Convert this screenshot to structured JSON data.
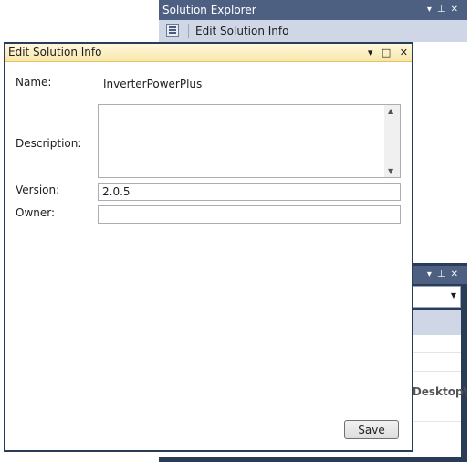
{
  "solution_explorer": {
    "title": "Solution Explorer",
    "title_buttons": [
      "▾",
      "⊥",
      "✕"
    ],
    "toolbar": {
      "label": "Edit Solution Info"
    }
  },
  "properties_panel": {
    "title_buttons": [
      "▾",
      "⊥",
      "✕"
    ],
    "path_fragment": "Desktop\\"
  },
  "dialog": {
    "title": "Edit Solution Info",
    "title_buttons": {
      "dropdown": "▾",
      "maximize": "□",
      "close": "✕"
    },
    "fields": {
      "name": {
        "label": "Name:",
        "value": "InverterPowerPlus"
      },
      "description": {
        "label": "Description:",
        "value": ""
      },
      "version": {
        "label": "Version:",
        "value": "2.0.5"
      },
      "owner": {
        "label": "Owner:",
        "value": ""
      }
    },
    "save_label": "Save"
  }
}
